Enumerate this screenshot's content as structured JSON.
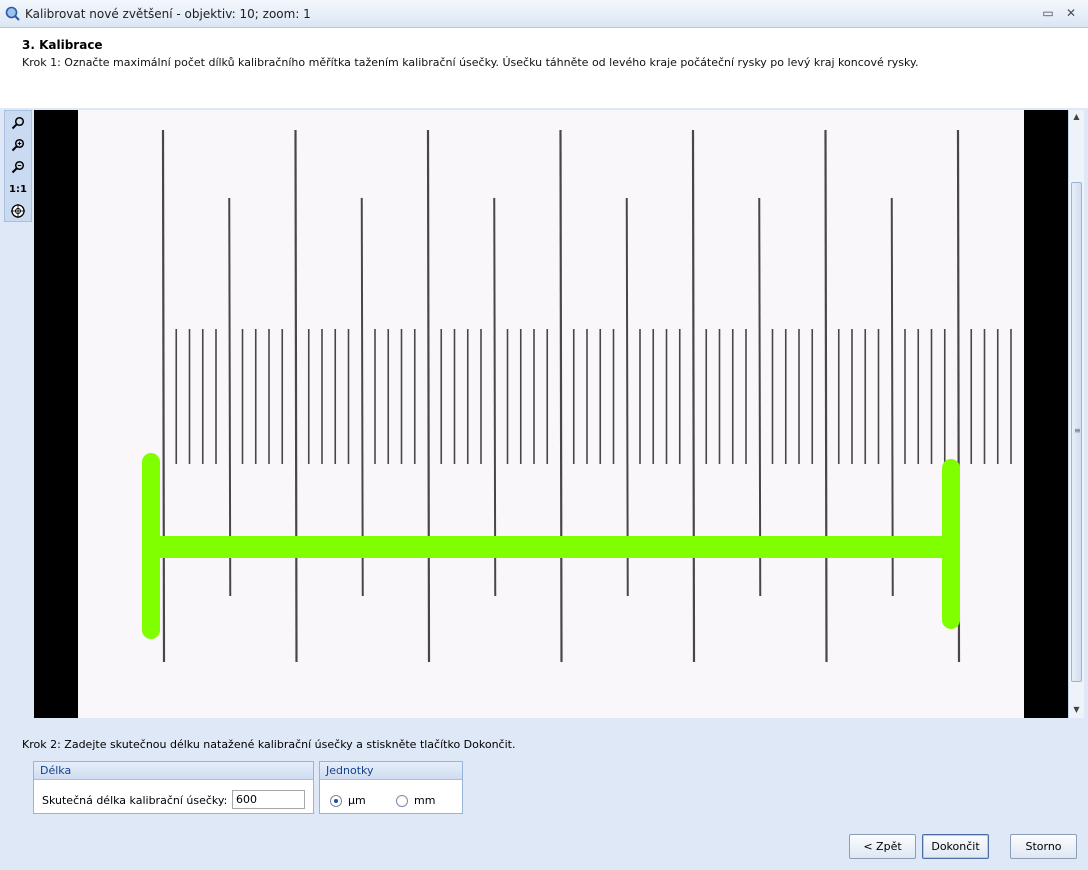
{
  "window": {
    "title": "Kalibrovat nové zvětšení - objektiv: 10; zoom: 1",
    "minimize_glyph": "▭",
    "close_glyph": "✕"
  },
  "header": {
    "step_title": "3. Kalibrace",
    "step1_text": "Krok 1: Označte maximální počet dílků kalibračního měřítka tažením kalibrační úsečky. Úsečku táhněte od levého kraje počáteční rysky po levý kraj koncové rysky."
  },
  "toolbar": {
    "tools": [
      {
        "icon": "zoom-icon"
      },
      {
        "icon": "zoom-in-icon"
      },
      {
        "icon": "zoom-out-icon"
      },
      {
        "label": "1:1",
        "icon": "actual-size"
      },
      {
        "icon": "fit-to-window-icon"
      }
    ]
  },
  "step2": {
    "text": "Krok 2: Zadejte skutečnou délku natažené kalibrační úsečky a stiskněte tlačítko Dokončit."
  },
  "length_group": {
    "title": "Délka",
    "label": "Skutečná délka kalibrační úsečky:",
    "value": "600"
  },
  "units_group": {
    "title": "Jednotky",
    "options": [
      {
        "label": "µm",
        "checked": true
      },
      {
        "label": "mm",
        "checked": false
      }
    ]
  },
  "buttons": {
    "back": "< Zpět",
    "finish": "Dokončit",
    "cancel": "Storno"
  },
  "colors": {
    "calibration_line": "#7fff00",
    "accent": "#15428b"
  }
}
